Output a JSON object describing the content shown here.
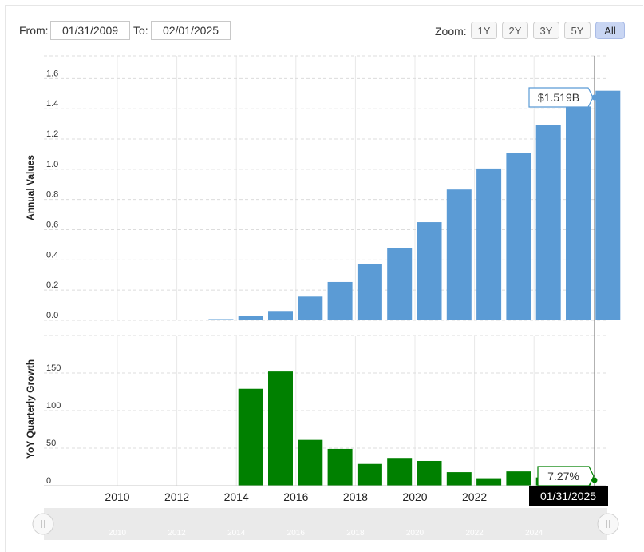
{
  "range": {
    "from_label": "From:",
    "from_value": "01/31/2009",
    "to_label": "To:",
    "to_value": "02/01/2025"
  },
  "zoom": {
    "label": "Zoom:",
    "buttons": [
      {
        "label": "1Y",
        "active": false
      },
      {
        "label": "2Y",
        "active": false
      },
      {
        "label": "3Y",
        "active": false
      },
      {
        "label": "5Y",
        "active": false
      },
      {
        "label": "All",
        "active": true
      }
    ]
  },
  "colors": {
    "annual": "#5b9bd5",
    "growth": "#008000",
    "grid": "#e0e0e0",
    "tooltip_border": "#5b9bd5",
    "crosshair_label_bg": "#000000"
  },
  "chart_data": [
    {
      "type": "bar",
      "ylabel": "Annual Values",
      "ylim": [
        0,
        1.75
      ],
      "yticks": [
        "0.0",
        "0.2",
        "0.4",
        "0.6",
        "0.8",
        "1.0",
        "1.2",
        "1.4",
        "1.6"
      ],
      "grid": true,
      "x": [
        2009,
        2010,
        2011,
        2012,
        2013,
        2014,
        2015,
        2016,
        2017,
        2018,
        2019,
        2020,
        2021,
        2022,
        2023,
        2024,
        2025
      ],
      "values": [
        0.004,
        0.0,
        0.004,
        0.0,
        0.008,
        0.028,
        0.062,
        0.157,
        0.254,
        0.375,
        0.48,
        0.65,
        0.866,
        1.005,
        1.105,
        1.29,
        1.415,
        1.519
      ],
      "tooltip": "$1.519B"
    },
    {
      "type": "bar",
      "ylabel": "YoY Quarterly Growth",
      "ylim": [
        0,
        200
      ],
      "yticks": [
        "0",
        "50",
        "100",
        "150"
      ],
      "grid": true,
      "x": [
        2014,
        2015,
        2016,
        2017,
        2018,
        2019,
        2020,
        2021,
        2022,
        2023,
        2024,
        2025
      ],
      "values": [
        129,
        152,
        61,
        49,
        29,
        37,
        33,
        18,
        10,
        19,
        11,
        7.27
      ],
      "tooltip": "7.27%"
    }
  ],
  "xaxis": {
    "ticks": [
      "2010",
      "2012",
      "2014",
      "2016",
      "2018",
      "2020",
      "2022",
      "2024"
    ],
    "crosshair_label": "01/31/2025"
  },
  "navigator": {
    "ticks": [
      "2010",
      "2012",
      "2014",
      "2016",
      "2018",
      "2020",
      "2022",
      "2024"
    ]
  }
}
